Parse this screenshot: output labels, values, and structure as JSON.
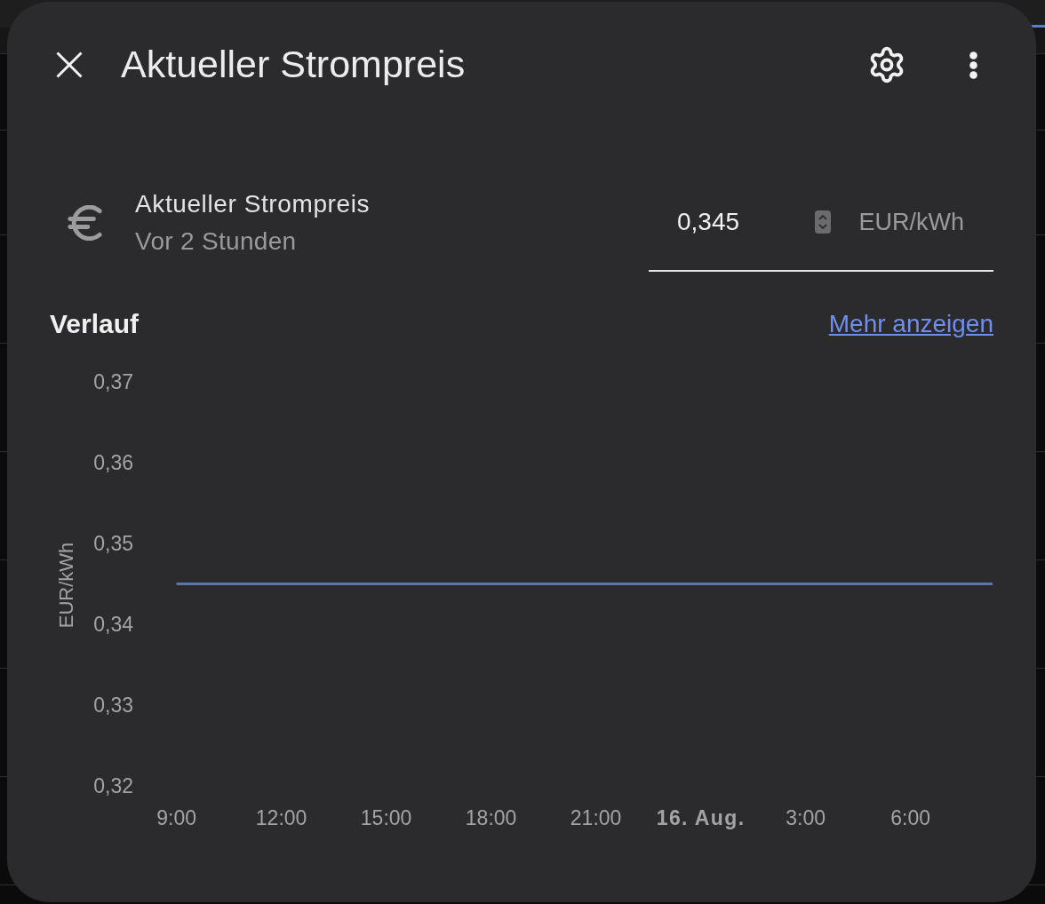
{
  "dialog": {
    "title": "Aktueller Strompreis"
  },
  "entity": {
    "name": "Aktueller Strompreis",
    "last_changed": "Vor 2 Stunden",
    "value": "0,345",
    "unit": "EUR/kWh"
  },
  "history": {
    "title": "Verlauf",
    "more_link": "Mehr anzeigen",
    "chart_data": {
      "type": "line",
      "ylabel": "EUR/kWh",
      "categories": [
        "9:00",
        "12:00",
        "15:00",
        "18:00",
        "21:00",
        "16. Aug.",
        "3:00",
        "6:00"
      ],
      "series": [
        {
          "color": "#5b76ad",
          "values": [
            0.345,
            0.345,
            0.345,
            0.345,
            0.345,
            0.345,
            0.345,
            0.345
          ]
        }
      ],
      "ylim": [
        0.32,
        0.37
      ],
      "yticks": [
        {
          "value": 0.32,
          "label": "0,32"
        },
        {
          "value": 0.33,
          "label": "0,33"
        },
        {
          "value": 0.34,
          "label": "0,34"
        },
        {
          "value": 0.35,
          "label": "0,35"
        },
        {
          "value": 0.36,
          "label": "0,36"
        },
        {
          "value": 0.37,
          "label": "0,37"
        }
      ]
    }
  }
}
